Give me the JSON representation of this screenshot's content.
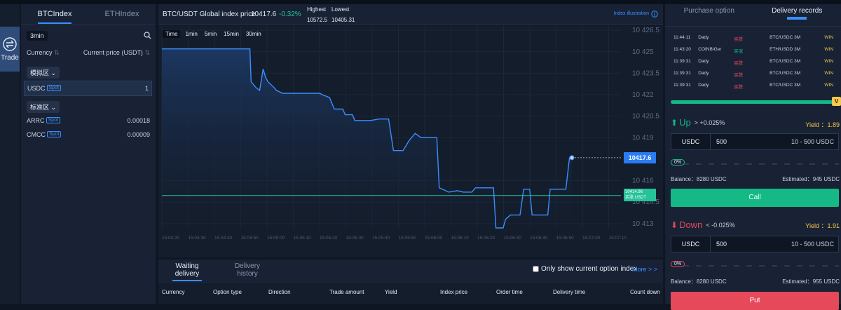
{
  "nav": {
    "trade_label": "Trade"
  },
  "left": {
    "tabs": [
      "BTCIndex",
      "ETHIndex"
    ],
    "interval": "3min",
    "col_currency": "Currency",
    "col_price": "Current price (USDT)",
    "group1": "模拟区",
    "group2": "标准区",
    "spot_label": "Spot",
    "rows1": [
      {
        "name": "USDC",
        "value": "1"
      }
    ],
    "rows2": [
      {
        "name": "ARRC",
        "value": "0.00018"
      },
      {
        "name": "CMCC",
        "value": "0.00009"
      }
    ]
  },
  "header": {
    "pair": "BTC/USDT Global index price",
    "price": "10417.6",
    "change": "-0.32%",
    "highest_label": "Highest",
    "lowest_label": "Lowest",
    "highest": "10572.5",
    "lowest": "10405.31",
    "index_link": "Index illustration"
  },
  "chart_data": {
    "type": "area",
    "timeframes": [
      "Time",
      "1min",
      "5min",
      "15min",
      "30min"
    ],
    "y_ticks": [
      "10 426.5",
      "10 425",
      "10 423.5",
      "10 422",
      "10 420.5",
      "10 419",
      "10 416",
      "10 414.5",
      "10 413"
    ],
    "x_ticks": [
      "15:04:20",
      "15:04:30",
      "15:04:40",
      "15:04:50",
      "15:05:00",
      "15:05:10",
      "15:05:20",
      "15:05:30",
      "15:05:40",
      "15:05:50",
      "15:06:00",
      "15:06:10",
      "15:06:20",
      "15:06:30",
      "15:06:40",
      "15:06:50",
      "15:07:00",
      "15:07:10"
    ],
    "ylim": [
      10412.6,
      10426.8
    ],
    "points": [
      [
        0,
        10425.2
      ],
      [
        12,
        10425.2
      ],
      [
        26,
        10425.2
      ],
      [
        40,
        10425.2
      ],
      [
        53,
        10425.2
      ],
      [
        65,
        10425.2
      ],
      [
        73,
        10425.2
      ],
      [
        74,
        10422.9
      ],
      [
        78,
        10422.5
      ],
      [
        81,
        10422.3
      ],
      [
        84,
        10423.8
      ],
      [
        86,
        10423.2
      ],
      [
        88,
        10422.9
      ],
      [
        93,
        10422.5
      ],
      [
        95,
        10422.3
      ],
      [
        100,
        10422.1
      ],
      [
        110,
        10422.1
      ],
      [
        120,
        10422.1
      ],
      [
        131,
        10422.1
      ],
      [
        133,
        10422.0
      ],
      [
        139,
        10421.8
      ],
      [
        143,
        10421.0
      ],
      [
        145,
        10421.0
      ],
      [
        150,
        10421.0
      ],
      [
        152,
        10420.6
      ],
      [
        158,
        10420.6
      ],
      [
        160,
        10420.2
      ],
      [
        173,
        10420.2
      ],
      [
        180,
        10420.3
      ],
      [
        188,
        10420.3
      ],
      [
        192,
        10418.1
      ],
      [
        200,
        10418.1
      ],
      [
        205,
        10418.8
      ],
      [
        210,
        10419.3
      ],
      [
        215,
        10419.0
      ],
      [
        220,
        10419.0
      ],
      [
        222,
        10419.0
      ],
      [
        228,
        10419.0
      ],
      [
        230,
        10415.5
      ],
      [
        238,
        10415.2
      ],
      [
        245,
        10415.3
      ],
      [
        250,
        10415.2
      ],
      [
        257,
        10415.2
      ],
      [
        260,
        10415.5
      ],
      [
        270,
        10415.5
      ],
      [
        275,
        10415.5
      ],
      [
        277,
        10412.7
      ],
      [
        283,
        10412.7
      ],
      [
        285,
        10413.3
      ],
      [
        289,
        10413.6
      ],
      [
        297,
        10413.6
      ],
      [
        300,
        10415.4
      ],
      [
        305,
        10415.4
      ],
      [
        307,
        10413.6
      ],
      [
        320,
        10413.6
      ],
      [
        322,
        10415.4
      ],
      [
        335,
        10415.4
      ],
      [
        338,
        10417.6
      ],
      [
        340,
        10417.6
      ]
    ],
    "last_price": "10417.6",
    "ref_line_value": 10414.96,
    "ref_label_value": "10414.96",
    "ref_label_text": "买涨 USDT",
    "colors": {
      "line": "#3a8eff",
      "ref": "#26c29a"
    }
  },
  "bottom": {
    "tabs": [
      "Waiting delivery",
      "Delivery history"
    ],
    "checkbox_label": "Only show current option index",
    "more": "More > >",
    "columns": [
      "Currency",
      "Option type",
      "Direction",
      "Trade amount",
      "Yield",
      "Index price",
      "Order time",
      "Delivery time",
      "Count down"
    ]
  },
  "right": {
    "tabs": [
      "Purchase option",
      "Delivery records"
    ],
    "records": [
      {
        "time": "11:44:11",
        "user": "Dady",
        "type": "买跌",
        "pair": "BTC/USDC 3M",
        "result": "WIN"
      },
      {
        "time": "11:43:20",
        "user": "COINBIGer",
        "type": "买涨",
        "pair": "ETH/USDD 3M",
        "result": "WIN"
      },
      {
        "time": "11:39:31",
        "user": "Dady",
        "type": "买跌",
        "pair": "BTC/USDC 3M",
        "result": "WIN"
      },
      {
        "time": "11:39:31",
        "user": "Dady",
        "type": "买跌",
        "pair": "BTC/USDC 3M",
        "result": "WIN"
      },
      {
        "time": "11:39:31",
        "user": "Dady",
        "type": "买跌",
        "pair": "BTC/USDC 3M",
        "result": "WIN"
      }
    ],
    "up": {
      "label": "Up",
      "threshold": "> +0.025%",
      "yield_label": "Yield ：1.89",
      "currency": "USDC",
      "amount": "500",
      "range": "10 - 500 USDC",
      "percent": "0%",
      "balance": "Balance：8280 USDC",
      "estimated": "Estimated：945 USDC",
      "button": "Call"
    },
    "down": {
      "label": "Down",
      "threshold": "< -0.025%",
      "yield_label": "Yield ：1.91",
      "currency": "USDC",
      "amount": "500",
      "range": "10 - 500 USDC",
      "percent": "0%",
      "balance": "Balance：8280 USDC",
      "estimated": "Estimated：955 USDC",
      "button": "Put"
    },
    "colors": {
      "up": "#14b985",
      "down": "#e5495a",
      "yield": "#f7c948"
    }
  }
}
